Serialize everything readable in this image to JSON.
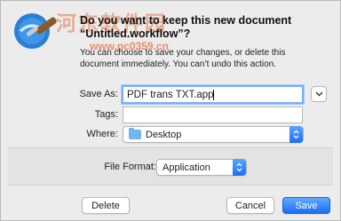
{
  "watermark": {
    "brand": "河东软件园",
    "url": "www.pc0359.cn"
  },
  "dialog": {
    "title": "Do you want to keep this new document “Untitled.workflow”?",
    "message": "You can choose to save your changes, or delete this document immediately. You can’t undo this action."
  },
  "fields": {
    "save_as_label": "Save As:",
    "save_as_value": "PDF trans  TXT.app",
    "tags_label": "Tags:",
    "tags_value": "",
    "where_label": "Where:",
    "where_value": "Desktop",
    "file_format_label": "File Format:",
    "file_format_value": "Application"
  },
  "buttons": {
    "delete": "Delete",
    "cancel": "Cancel",
    "save": "Save"
  },
  "colors": {
    "accent": "#1d6ff2",
    "folder": "#6fb6f2"
  },
  "icons": {
    "app": "automator-robot-icon",
    "expand": "chevron-down-icon",
    "folder": "folder-icon",
    "popup_arrows": "updown-arrows-icon"
  }
}
